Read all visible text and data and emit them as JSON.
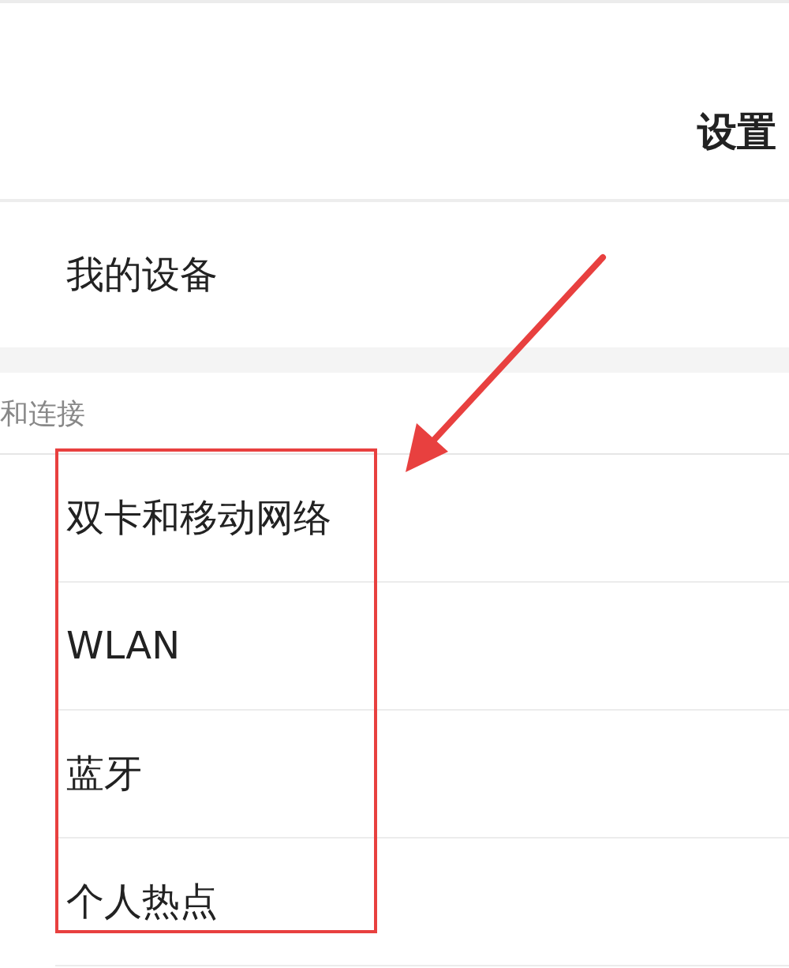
{
  "header": {
    "title": "设置"
  },
  "device_row": {
    "label": "我的设备"
  },
  "section": {
    "title": "和连接",
    "items": [
      {
        "label": "双卡和移动网络"
      },
      {
        "label": "WLAN"
      },
      {
        "label": "蓝牙"
      },
      {
        "label": "个人热点"
      }
    ]
  },
  "annotations": {
    "highlight_box": true,
    "pointer_arrow": true
  }
}
